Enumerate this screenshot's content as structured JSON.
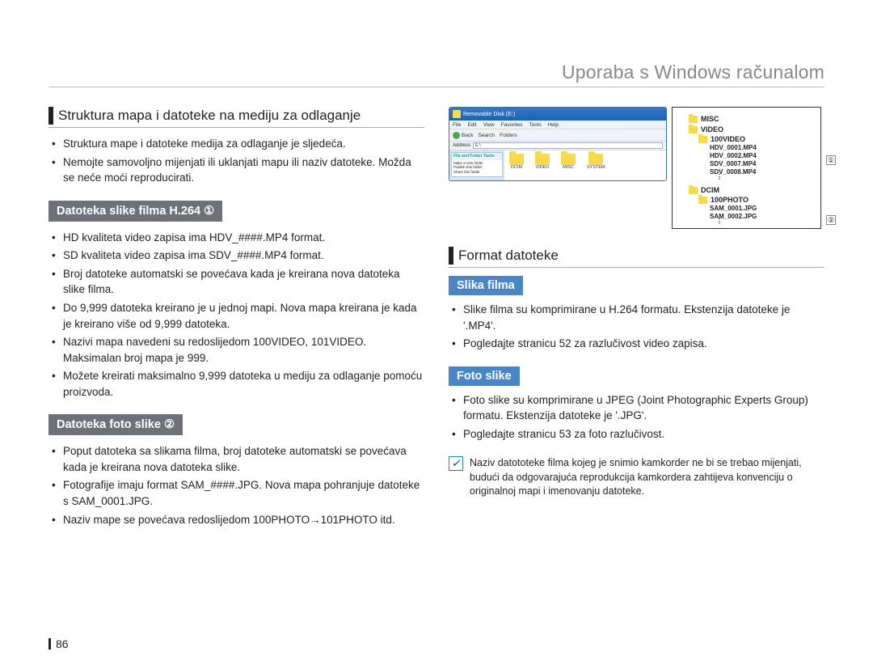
{
  "chapter": "Uporaba s Windows računalom",
  "sec_structure_heading": "Struktura mapa i datoteke na mediju za odlaganje",
  "structure_bullets": [
    "Struktura mape i datoteke medija za odlaganje je sljedeća.",
    "Nemojte samovoljno mijenjati ili uklanjati mapu ili naziv datoteke. Možda se neće moći reproducirati."
  ],
  "h264_label": "Datoteka slike filma H.264 ①",
  "h264_bullets": [
    "HD kvaliteta video zapisa ima HDV_####.MP4 format.",
    "SD kvaliteta video zapisa ima SDV_####.MP4 format.",
    "Broj datoteke automatski se povećava kada je kreirana nova datoteka slike filma.",
    "Do 9,999 datoteka kreirano je u jednoj mapi. Nova mapa kreirana je kada je kreirano više od 9,999 datoteka.",
    "Nazivi mapa navedeni su redoslijedom 100VIDEO, 101VIDEO. Maksimalan broj mapa je 999.",
    "Možete kreirati maksimalno 9,999 datoteka u mediju za odlaganje pomoću proizvoda."
  ],
  "photo_label": "Datoteka foto slike ②",
  "photo_bullets": [
    "Poput datoteka sa slikama filma, broj datoteke automatski se povećava kada je kreirana nova datoteka slike.",
    "Fotografije imaju format SAM_####.JPG. Nova mapa pohranjuje datoteke s SAM_0001.JPG.",
    "Naziv mape se povećava redoslijedom 100PHOTO→101PHOTO itd."
  ],
  "explorer": {
    "title": "Removable Disk (E:)",
    "menu": [
      "File",
      "Edit",
      "View",
      "Favorites",
      "Tools",
      "Help"
    ],
    "toolbar": {
      "back": "Back",
      "search": "Search",
      "folders": "Folders"
    },
    "address": "E:\\",
    "task_hdr": "File and Folder Tasks",
    "task_items": [
      "Make a new folder",
      "Publish this folder",
      "Share this folder"
    ],
    "folders": [
      "DCIM",
      "VIDEO",
      "MISC",
      "SYSTEM"
    ]
  },
  "tree": {
    "root_misc": "MISC",
    "root_video": "VIDEO",
    "video_sub": "100VIDEO",
    "files_video": [
      "HDV_0001.MP4",
      "HDV_0002.MP4",
      "SDV_0007.MP4",
      "SDV_0008.MP4"
    ],
    "root_dcim": "DCIM",
    "dcim_sub": "100PHOTO",
    "files_photo": [
      "SAM_0001.JPG",
      "SAM_0002.JPG"
    ],
    "callout1": "①",
    "callout2": "②"
  },
  "format_heading": "Format datoteke",
  "film_label": "Slika filma",
  "film_bullets": [
    "Slike filma su komprimirane u H.264 formatu. Ekstenzija datoteke je '.MP4'.",
    "Pogledajte stranicu 52 za razlučivost video zapisa."
  ],
  "foto_label": "Foto slike",
  "foto_bullets": [
    "Foto slike su komprimirane u JPEG (Joint Photographic Experts Group) formatu. Ekstenzija datoteke je '.JPG'.",
    "Pogledajte stranicu 53 za foto razlučivost."
  ],
  "note": "Naziv datototeke filma kojeg je snimio kamkorder ne bi se trebao mijenjati, budući da odgovarajuća reprodukcija kamkordera zahtijeva konvenciju o originalnoj mapi i imenovanju datoteke.",
  "page": "86"
}
